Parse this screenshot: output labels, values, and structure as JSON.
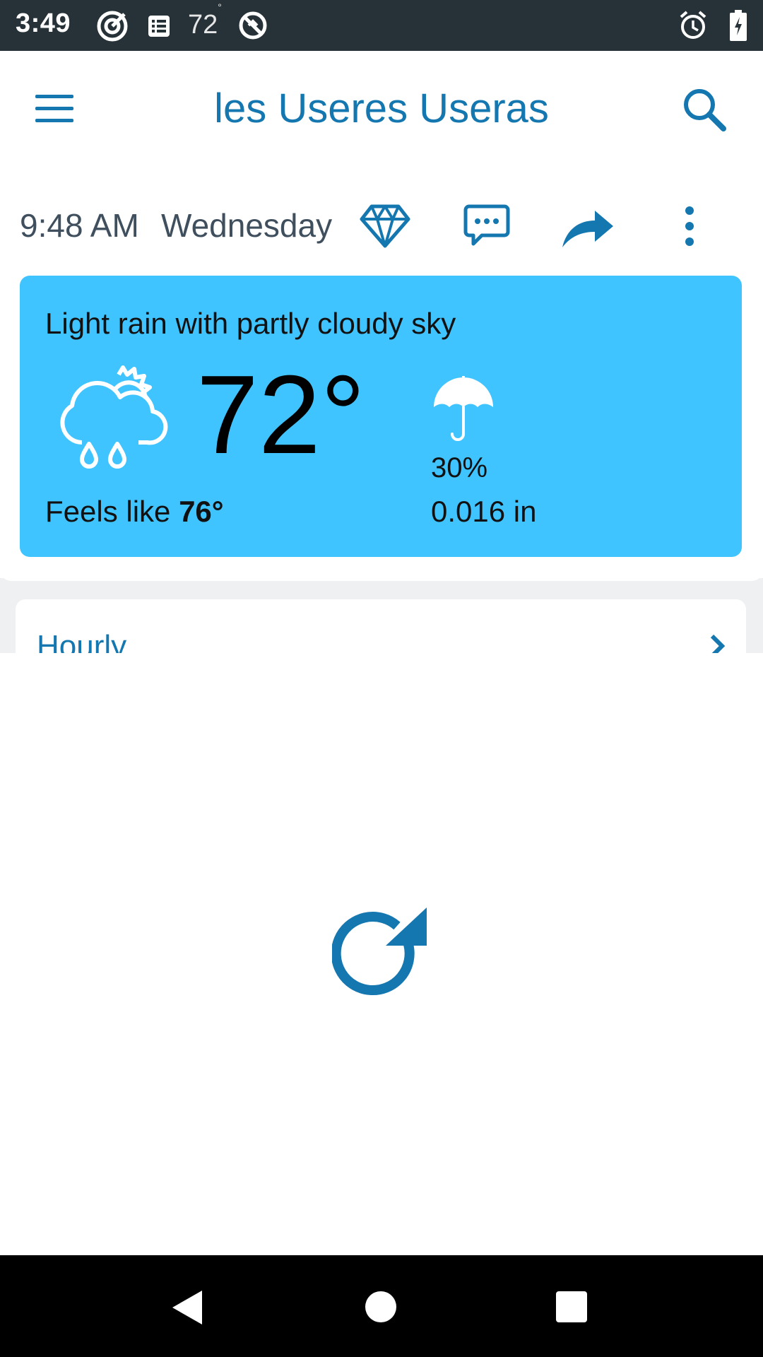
{
  "status_bar": {
    "time": "3:49",
    "temp": "72",
    "temp_degree": "°",
    "icons": [
      "target-icon",
      "list-icon",
      "no-sync-icon",
      "alarm-icon",
      "battery-charging-icon"
    ]
  },
  "header": {
    "title": "les Useres Useras",
    "menu_icon": "hamburger-menu-icon",
    "search_icon": "search-icon"
  },
  "subheader": {
    "time": "9:48 AM",
    "day": "Wednesday",
    "actions": [
      "diamond-icon",
      "chat-icon",
      "share-icon",
      "more-vert-icon"
    ]
  },
  "current": {
    "condition": "Light rain with partly cloudy sky",
    "temperature": "72°",
    "feels_like_label": "Feels like",
    "feels_like_value": "76°",
    "precip_chance": "30%",
    "precip_amount": "0.016 in",
    "condition_icon": "rain-cloud-sun-icon",
    "precip_icon": "umbrella-icon"
  },
  "hourly": {
    "label": "Hourly"
  },
  "colors": {
    "accent": "#1577b0",
    "card": "#40c4ff",
    "status_bar": "#263238"
  }
}
